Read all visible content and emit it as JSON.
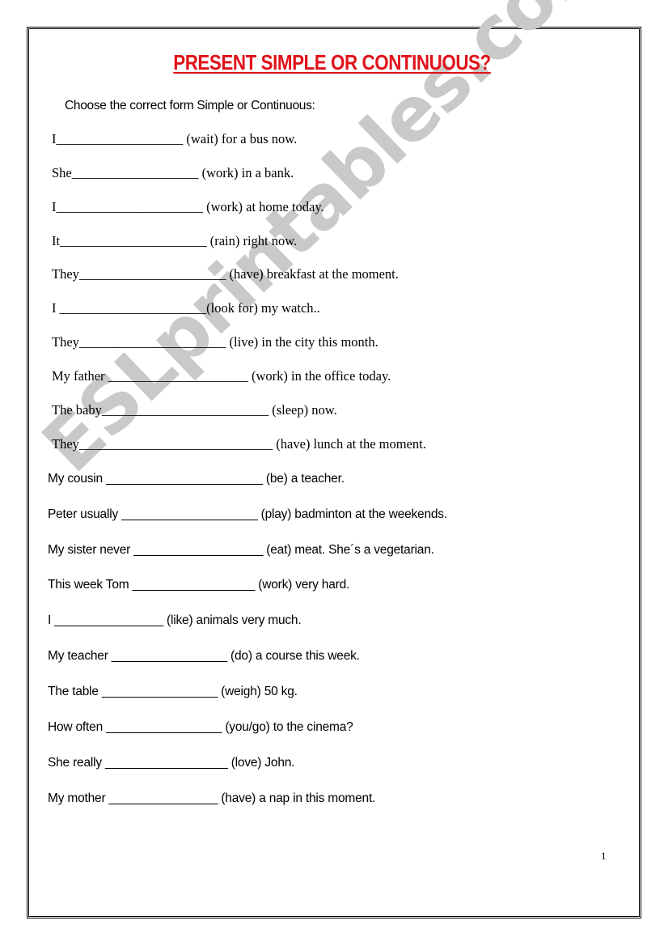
{
  "title": "PRESENT SIMPLE OR CONTINUOUS?",
  "instruction": "Choose the correct form Simple or Continuous:",
  "watermark": "ESLprintables.com",
  "colors": {
    "title": "#e0121a",
    "watermark": "#c9c9c9",
    "text": "#000000"
  },
  "exercises": [
    {
      "text": "I___________________ (wait) for a bus now.",
      "verb": "wait"
    },
    {
      "text": "She___________________ (work) in a bank.",
      "verb": "work"
    },
    {
      "text": "I______________________ (work) at home today.",
      "verb": "work"
    },
    {
      "text": "It______________________ (rain) right now.",
      "verb": "rain"
    },
    {
      "text": "They______________________ (have) breakfast at the moment.",
      "verb": "have"
    },
    {
      "text": "I ______________________(look for) my watch..",
      "verb": "look for"
    },
    {
      "text": "They______________________ (live) in the city this month.",
      "verb": "live"
    },
    {
      "text": "My father _____________________ (work) in the office today.",
      "verb": "work"
    },
    {
      "text": "The baby_________________________ (sleep) now.",
      "verb": "sleep"
    },
    {
      "text": "They_____________________________ (have) lunch at the moment.",
      "verb": "have"
    },
    {
      "text": "My cousin _______________________ (be) a teacher.",
      "verb": "be"
    },
    {
      "text": "Peter usually ____________________ (play) badminton at the weekends.",
      "verb": "play"
    },
    {
      "text": "My sister never ___________________ (eat) meat. She´s a vegetarian.",
      "verb": "eat"
    },
    {
      "text": "This week Tom __________________ (work) very hard.",
      "verb": "work"
    },
    {
      "text": "I ________________ (like) animals very much.",
      "verb": "like"
    },
    {
      "text": "My teacher _________________ (do) a course this week.",
      "verb": "do"
    },
    {
      "text": "The table _________________ (weigh) 50 kg.",
      "verb": "weigh"
    },
    {
      "text": "How often _________________ (you/go) to the cinema?",
      "verb": "you/go"
    },
    {
      "text": "She really __________________ (love) John.",
      "verb": "love"
    },
    {
      "text": "My mother ________________ (have) a nap in this moment.",
      "verb": "have"
    }
  ],
  "page_number": "1"
}
